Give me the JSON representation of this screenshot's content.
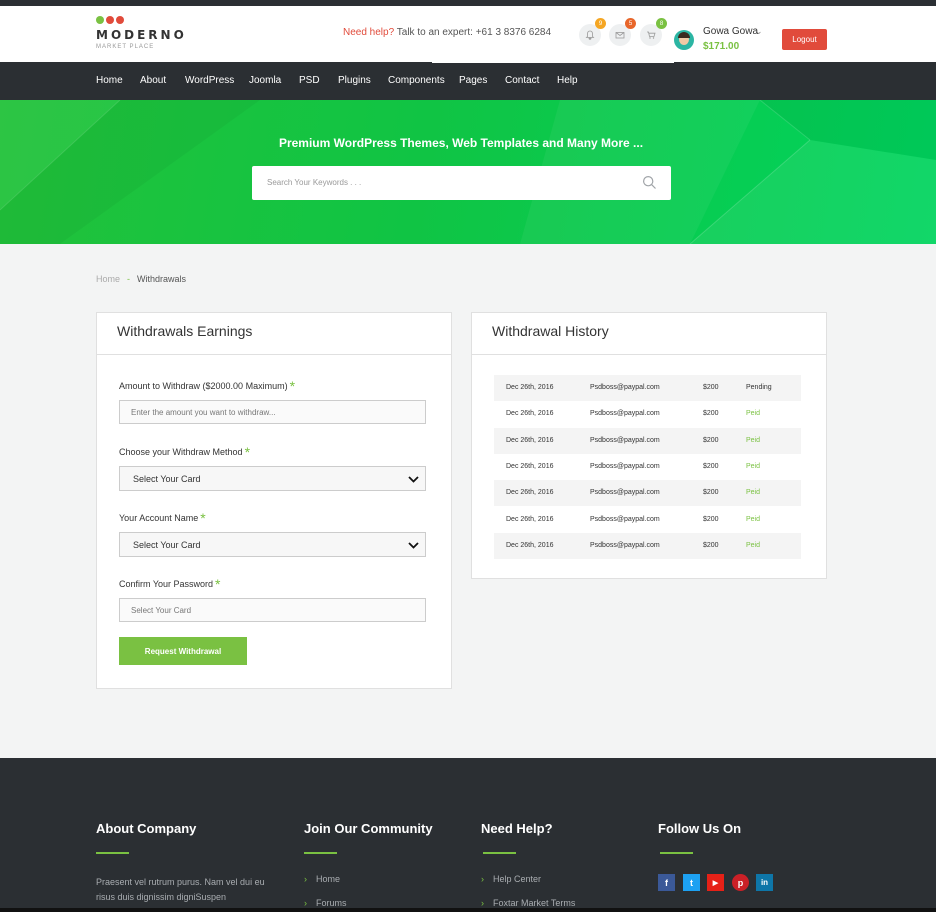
{
  "logo": {
    "name": "MODERNO",
    "sub": "MARKET PLACE",
    "dot_colors": [
      "#7ac142",
      "#e14b3b",
      "#e14b3b"
    ]
  },
  "header": {
    "help_red": "Need help?",
    "help_text": "Talk to an expert: +61 3 8376 6284",
    "icons": [
      {
        "name": "bell-icon",
        "badge": "9",
        "badge_color": "#f5a623"
      },
      {
        "name": "mail-icon",
        "badge": "5",
        "badge_color": "#e8662a"
      },
      {
        "name": "cart-icon",
        "badge": "8",
        "badge_color": "#7ac142"
      }
    ],
    "user_name": "Gowa Gowa",
    "balance": "$171.00",
    "logout": "Logout"
  },
  "nav": [
    "Home",
    "About",
    "WordPress",
    "Joomla",
    "PSD",
    "Plugins",
    "Components",
    "Pages",
    "Contact",
    "Help"
  ],
  "hero": {
    "title": "Premium WordPress Themes, Web Templates and Many More ...",
    "search_placeholder": "Search Your Keywords . . ."
  },
  "breadcrumb": {
    "home": "Home",
    "sep": "-",
    "current": "Withdrawals"
  },
  "withdraw": {
    "title": "Withdrawals Earnings",
    "amount_label": "Amount to Withdraw ($2000.00 Maximum)",
    "amount_placeholder": "Enter the amount you want to withdraw...",
    "method_label": "Choose your Withdraw Method",
    "method_value": "Select Your Card",
    "account_label": "Your Account Name",
    "account_value": "Select Your Card",
    "password_label": "Confirm Your Password",
    "password_placeholder": "Select Your Card",
    "star": "*",
    "button": "Request Withdrawal"
  },
  "history": {
    "title": "Withdrawal History",
    "rows": [
      {
        "date": "Dec 26th, 2016",
        "email": "Psdboss@paypal.com",
        "amount": "$200",
        "status": "Pending"
      },
      {
        "date": "Dec 26th, 2016",
        "email": "Psdboss@paypal.com",
        "amount": "$200",
        "status": "Peid"
      },
      {
        "date": "Dec 26th, 2016",
        "email": "Psdboss@paypal.com",
        "amount": "$200",
        "status": "Peid"
      },
      {
        "date": "Dec 26th, 2016",
        "email": "Psdboss@paypal.com",
        "amount": "$200",
        "status": "Peid"
      },
      {
        "date": "Dec 26th, 2016",
        "email": "Psdboss@paypal.com",
        "amount": "$200",
        "status": "Peid"
      },
      {
        "date": "Dec 26th, 2016",
        "email": "Psdboss@paypal.com",
        "amount": "$200",
        "status": "Peid"
      },
      {
        "date": "Dec 26th, 2016",
        "email": "Psdboss@paypal.com",
        "amount": "$200",
        "status": "Peid"
      }
    ]
  },
  "footer": {
    "about_title": "About Company",
    "about_text": "Praesent vel rutrum purus. Nam vel dui eu risus duis dignissim digniSuspen",
    "community_title": "Join Our Community",
    "community_links": [
      "Home",
      "Forums"
    ],
    "help_title": "Need Help?",
    "help_links": [
      "Help Center",
      "Foxtar Market Terms"
    ],
    "follow_title": "Follow Us On",
    "social": [
      {
        "name": "facebook-icon",
        "glyph": "f",
        "color": "#3b5998"
      },
      {
        "name": "twitter-icon",
        "glyph": "t",
        "color": "#1da1f2"
      },
      {
        "name": "youtube-icon",
        "glyph": "▶",
        "color": "#e62117"
      },
      {
        "name": "pinterest-icon",
        "glyph": "p",
        "color": "#cb2027"
      },
      {
        "name": "linkedin-icon",
        "glyph": "in",
        "color": "#0e76a8"
      }
    ],
    "accent": "#7ac142"
  }
}
